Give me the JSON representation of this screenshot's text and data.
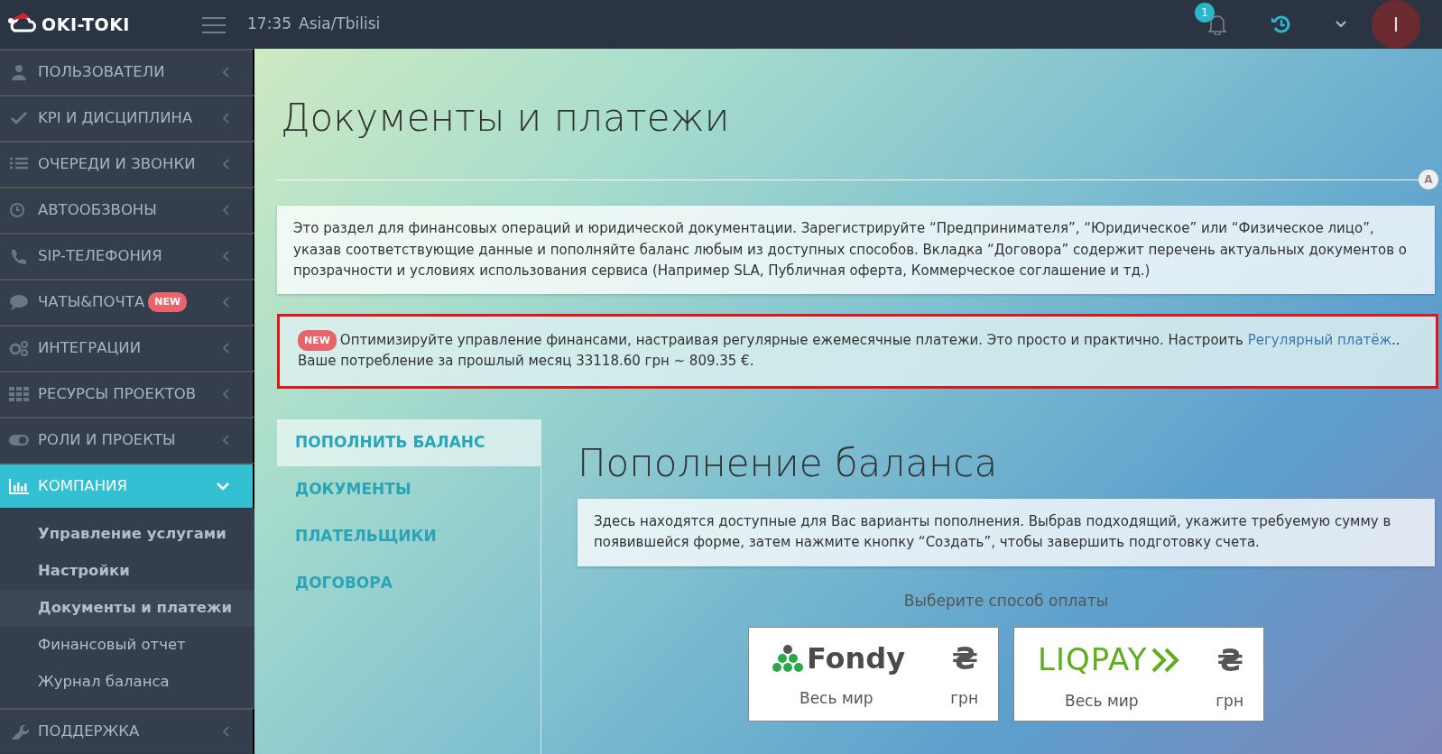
{
  "header": {
    "logo": "OKI-TOKI",
    "time": "17:35",
    "timezone": "Asia/Tbilisi",
    "notifications": "1",
    "avatar": "I"
  },
  "sidebar": {
    "items": [
      {
        "label": "ПОЛЬЗОВАТЕЛИ",
        "expanded": false
      },
      {
        "label": "KPI И ДИСЦИПЛИНА",
        "expanded": false
      },
      {
        "label": "ОЧЕРЕДИ И ЗВОНКИ",
        "expanded": false
      },
      {
        "label": "АВТООБЗВОНЫ",
        "expanded": false
      },
      {
        "label": "SIP-ТЕЛЕФОНИЯ",
        "expanded": false
      },
      {
        "label": "ЧАТЫ&ПОЧТА",
        "expanded": false,
        "badge": "NEW"
      },
      {
        "label": "ИНТЕГРАЦИИ",
        "expanded": false
      },
      {
        "label": "РЕСУРСЫ ПРОЕКТОВ",
        "expanded": false
      },
      {
        "label": "РОЛИ И ПРОЕКТЫ",
        "expanded": false
      },
      {
        "label": "КОМПАНИЯ",
        "expanded": true,
        "children": [
          {
            "label": "Управление услугами",
            "selected": false,
            "bold": true
          },
          {
            "label": "Настройки",
            "selected": false,
            "bold": true
          },
          {
            "label": "Документы и платежи",
            "selected": true,
            "bold": true
          },
          {
            "label": "Финансовый отчет",
            "selected": false,
            "bold": false
          },
          {
            "label": "Журнал баланса",
            "selected": false,
            "bold": false
          }
        ]
      },
      {
        "label": "ПОДДЕРЖКА",
        "expanded": false
      }
    ]
  },
  "page": {
    "title": "Документы и платежи",
    "divider_badge": "A",
    "intro": "Это раздел для финансовых операций и юридической документации. Зарегистрируйте “Предпринимателя”, “Юридическое” или “Физическое лицо”, указав соответствующие данные и пополняйте баланс любым из доступных способов. Вкладка “Договора” содержит перечень актуальных документов о прозрачности и условиях использования сервиса (Например SLA, Публичная оферта, Коммерческое соглашение и тд.)",
    "notice": {
      "badge": "NEW",
      "text": "Оптимизируйте управление финансами, настраивая регулярные ежемесячные платежи. Это просто и практично. Настроить",
      "link": "Регулярный платёж",
      "after": "..",
      "line2": "Ваше потребление за прошлый месяц 33118.60 грн ~ 809.35 €."
    },
    "tabs": [
      {
        "label": "ПОПОЛНИТЬ БАЛАНС",
        "selected": true
      },
      {
        "label": "ДОКУМЕНТЫ",
        "selected": false
      },
      {
        "label": "ПЛАТЕЛЬЩИКИ",
        "selected": false
      },
      {
        "label": "ДОГОВОРА",
        "selected": false
      }
    ],
    "section": {
      "title": "Пополнение баланса",
      "info": "Здесь находятся доступные для Вас варианты пополнения. Выбрав подходящий, укажите требуемую сумму в появившейся форме, затем нажмите кнопку “Создать”, чтобы завершить подготовку счета.",
      "prompt": "Выберите способ оплаты",
      "methods": [
        {
          "kind": "fondy",
          "name": "Fondy",
          "region": "Весь мир",
          "currency_sign": "₴",
          "currency": "грн"
        },
        {
          "kind": "liqpay",
          "name": "LIQPAY",
          "region": "Весь мир",
          "currency_sign": "₴",
          "currency": "грн"
        }
      ]
    }
  }
}
